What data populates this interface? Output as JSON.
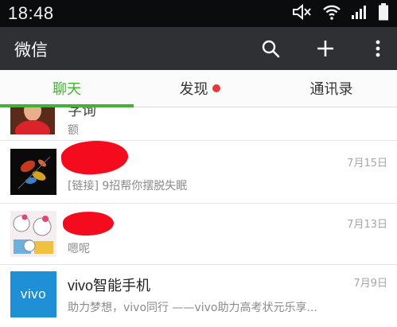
{
  "status_bar": {
    "time": "18:48",
    "icons": [
      "mute-icon",
      "wifi-icon",
      "signal-icon",
      "battery-icon"
    ]
  },
  "app_bar": {
    "title": "微信",
    "actions": [
      "search-icon",
      "plus-icon",
      "more-vertical-icon"
    ]
  },
  "tabs": [
    {
      "label": "聊天",
      "active": true
    },
    {
      "label": "发现",
      "badge": true
    },
    {
      "label": "通讯录"
    }
  ],
  "chats": [
    {
      "name": "字询",
      "preview": "额",
      "time": ""
    },
    {
      "name": "",
      "preview": "[链接] 9招帮你摆脱失眠",
      "time": "7月15日"
    },
    {
      "name": "",
      "preview": "嗯呢",
      "time": "7月13日"
    },
    {
      "name": "vivo智能手机",
      "preview": "助力梦想，vivo同行 ——vivo助力高考状元乐享...",
      "time": "7月9日",
      "avatar_text": "vivo"
    }
  ],
  "colors": {
    "accent_green": "#45b035",
    "app_bar": "#2f3033",
    "status_bar": "#0b0c0d",
    "badge_red": "#e5393c",
    "vivo_blue": "#1f8fd6"
  }
}
